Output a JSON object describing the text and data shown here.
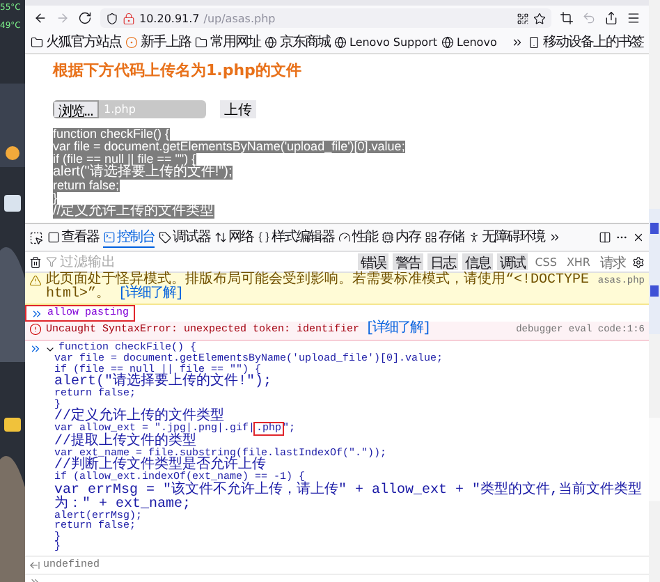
{
  "desktop": {
    "readings": [
      "55°C",
      "49°C"
    ]
  },
  "browser": {
    "address": {
      "host": "10.20.91.7",
      "path": "/up/asas.php"
    },
    "bookmarks": [
      {
        "kind": "folder",
        "label": "火狐官方站点"
      },
      {
        "kind": "firefox",
        "label": "新手上路"
      },
      {
        "kind": "folder",
        "label": "常用网址"
      },
      {
        "kind": "globe",
        "label": "京东商城"
      },
      {
        "kind": "globe",
        "label": "Lenovo Support"
      },
      {
        "kind": "globe",
        "label": "Lenovo"
      }
    ],
    "mobile_bookmarks": "移动设备上的书签"
  },
  "page": {
    "heading": "根据下方代码上传名为1.php的文件",
    "browse_button": "浏览...",
    "file_name": "1.php",
    "upload_button": "上传",
    "code_selected": true,
    "code_lines": [
      "function checkFile() {",
      "var file = document.getElementsByName('upload_file')[0].value;",
      "if (file == null || file == \"\") {",
      "alert(\"请选择要上传的文件!\");",
      "return false;",
      "}",
      "//定义允许上传的文件类型"
    ]
  },
  "devtools": {
    "tabs": [
      {
        "kind": "inspector",
        "label": "查看器",
        "selected": false
      },
      {
        "kind": "console",
        "label": "控制台",
        "selected": true
      },
      {
        "kind": "debugger",
        "label": "调试器",
        "selected": false
      },
      {
        "kind": "network",
        "label": "网络",
        "selected": false
      },
      {
        "kind": "style",
        "label": "样式编辑器",
        "selected": false
      },
      {
        "kind": "performance",
        "label": "性能",
        "selected": false
      },
      {
        "kind": "memory",
        "label": "内存",
        "selected": false
      },
      {
        "kind": "storage",
        "label": "存储",
        "selected": false
      },
      {
        "kind": "accessibility",
        "label": "无障碍环境",
        "selected": false
      }
    ],
    "filter_placeholder": "过滤输出",
    "levels": [
      {
        "label": "错误",
        "selected": true
      },
      {
        "label": "警告",
        "selected": true
      },
      {
        "label": "日志",
        "selected": true
      },
      {
        "label": "信息",
        "selected": true
      },
      {
        "label": "调试",
        "selected": true
      },
      {
        "label": "CSS",
        "selected": false
      },
      {
        "label": "XHR",
        "selected": false
      },
      {
        "label": "请求",
        "selected": false
      }
    ],
    "messages": [
      {
        "kind": "warning",
        "text": "此页面处于怪异模式。排版布局可能会受到影响。若需要标准模式，请使用“<!DOCTYPE html>”。",
        "link": "[详细了解]",
        "source": "asas.php"
      },
      {
        "kind": "input",
        "text": "allow pasting",
        "annotated": true
      },
      {
        "kind": "error",
        "text": "Uncaught SyntaxError: unexpected token: identifier",
        "link": "[详细了解]",
        "source": "debugger eval code:1:6"
      },
      {
        "kind": "code",
        "expanded": true,
        "head": "function checkFile() {",
        "lines": [
          {
            "text": "var file = document.getElementsByName('upload_file')[0].value;"
          },
          {
            "text": "if (file == null || file == \"\") {"
          },
          {
            "text": "alert(\"请选择要上传的文件!\");"
          },
          {
            "text": "return false;"
          },
          {
            "text": "}"
          },
          {
            "text": "//定义允许上传的文件类型"
          },
          {
            "text": "var allow_ext = \".jpg|.png|.gif|",
            "boxed": ".php",
            "after": "\";"
          },
          {
            "text": "//提取上传文件的类型"
          },
          {
            "text": "var ext_name = file.substring(file.lastIndexOf(\".\"));"
          },
          {
            "text": "//判断上传文件类型是否允许上传"
          },
          {
            "text": "if (allow_ext.indexOf(ext_name) == -1) {"
          },
          {
            "text": "var errMsg = \"该文件不允许上传，请上传\" + allow_ext + \"类型的文件,当前文件类型为：\" + ext_name;"
          },
          {
            "text": "alert(errMsg);"
          },
          {
            "text": "return false;"
          },
          {
            "text": "}"
          },
          {
            "text": "}"
          }
        ]
      },
      {
        "kind": "result",
        "text": "undefined"
      }
    ]
  }
}
